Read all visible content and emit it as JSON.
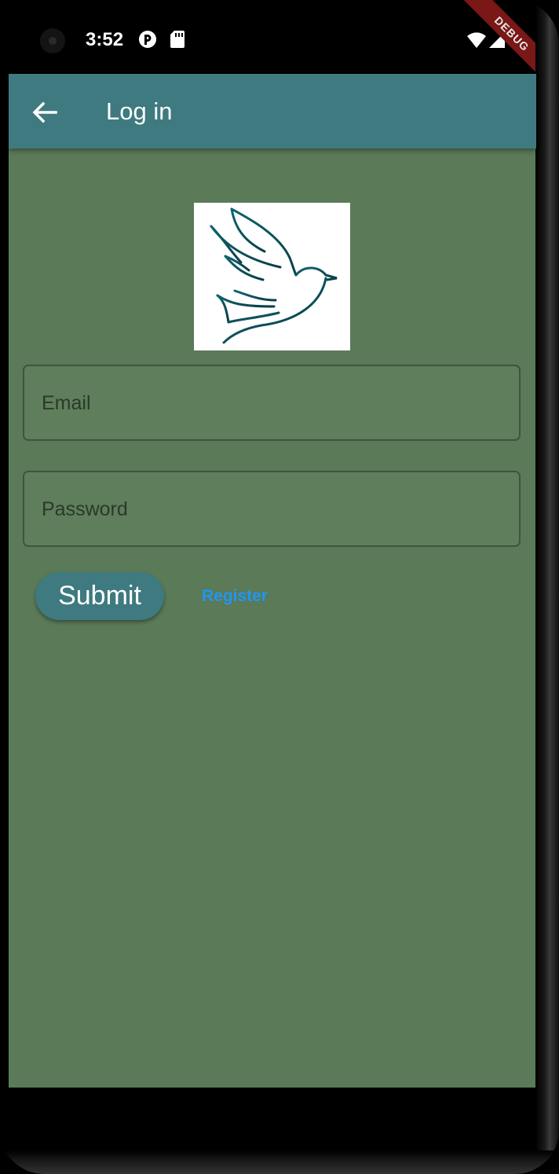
{
  "status_bar": {
    "time": "3:52",
    "icons": [
      "pocket-casts-icon",
      "sd-card-icon",
      "wifi-icon",
      "signal-icon",
      "battery-icon"
    ],
    "debug_banner": "DEBUG"
  },
  "app_bar": {
    "title": "Log in",
    "back_icon": "arrow-back-icon",
    "color": "#3e7a80"
  },
  "body": {
    "background": "#5a7a58",
    "logo_icon": "dove-icon",
    "email_field": {
      "placeholder": "Email",
      "value": ""
    },
    "password_field": {
      "placeholder": "Password",
      "value": ""
    },
    "submit_label": "Submit",
    "register_label": "Register",
    "link_color": "#2196f3"
  }
}
